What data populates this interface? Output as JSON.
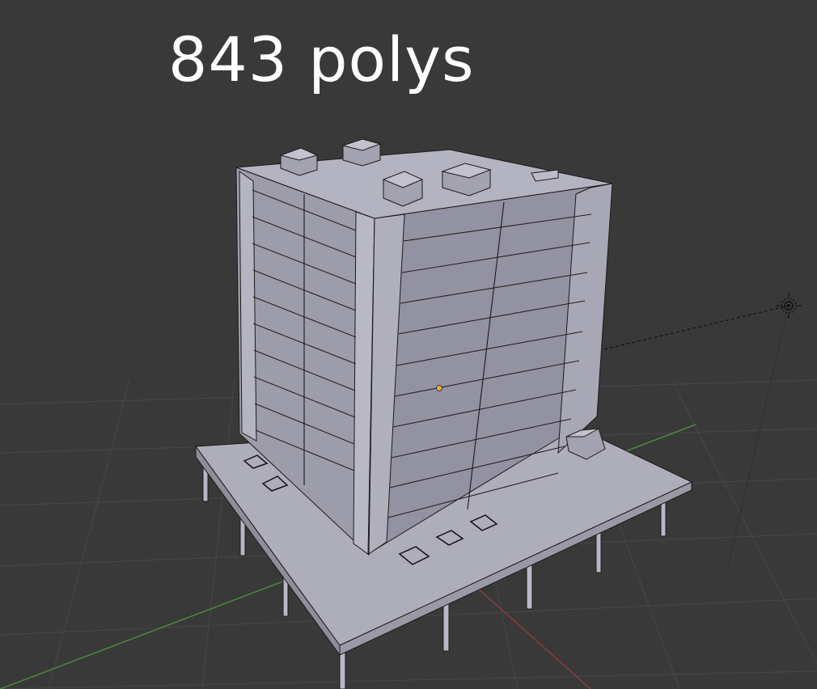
{
  "viewport": {
    "background_color": "#393939",
    "grid_color": "#444444",
    "x_axis_color": "#8c3b3b",
    "y_axis_color": "#4c8a3a",
    "overlay_label": "843 polys",
    "overlay_color": "#ffffff",
    "model_color": "#a6a6b6",
    "wire_color": "#111111",
    "origin_color": "#f0a040",
    "lamp_icon": "sun-lamp-icon"
  }
}
